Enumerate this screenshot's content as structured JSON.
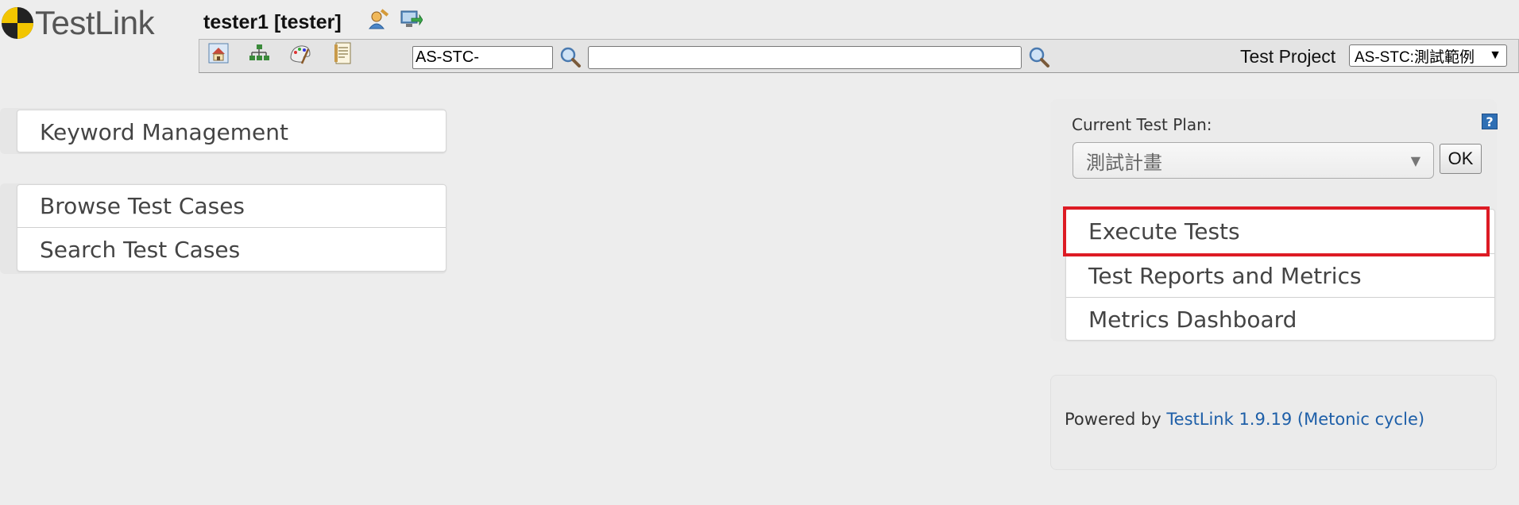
{
  "header": {
    "logo_text": "TestLink",
    "user": "tester1 [tester]"
  },
  "toolbar": {
    "icons": [
      "home-icon",
      "project-tree-icon",
      "test-specification-icon",
      "requirements-icon"
    ],
    "tc_prefix_value": "AS-STC-",
    "search_value": "",
    "project_label": "Test Project",
    "project_selected": "AS-STC:測試範例",
    "project_caret": "▼"
  },
  "left_menu": {
    "group1": [
      {
        "label": "Keyword Management"
      }
    ],
    "group2": [
      {
        "label": "Browse Test Cases"
      },
      {
        "label": "Search Test Cases"
      }
    ]
  },
  "right_panel": {
    "plan_label": "Current Test Plan:",
    "plan_selected": "測試計畫",
    "plan_caret": "▼",
    "ok_label": "OK",
    "help_glyph": "?",
    "items": [
      {
        "label": "Execute Tests"
      },
      {
        "label": "Test Reports and Metrics"
      },
      {
        "label": "Metrics Dashboard"
      }
    ]
  },
  "footer": {
    "powered_by": "Powered by",
    "link_text": "TestLink 1.9.19 (Metonic cycle)"
  },
  "colors": {
    "highlight": "#dd1b24",
    "link": "#1e5fa8"
  }
}
